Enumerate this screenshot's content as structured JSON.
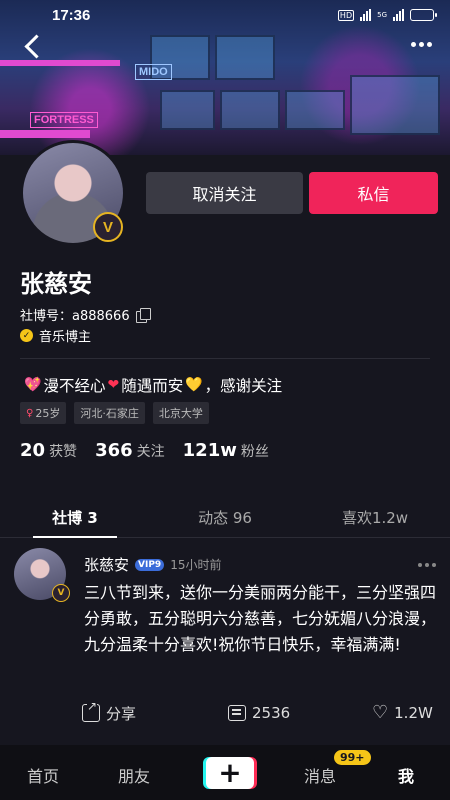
{
  "status": {
    "time": "17:36",
    "hd": "HD",
    "net": "5G",
    "battery_percent": 30
  },
  "banner": {
    "signs": [
      "FORTRESS",
      "MIDO"
    ]
  },
  "profile": {
    "name": "张慈安",
    "id_label": "社博号：a888666",
    "role": "音乐博主",
    "badge": "V",
    "bio_parts": [
      "漫不经心",
      "随遇而安",
      "，感谢关注"
    ],
    "tags": [
      "25岁",
      "河北·石家庄",
      "北京大学"
    ]
  },
  "actions": {
    "unfollow": "取消关注",
    "message": "私信"
  },
  "stats": [
    {
      "value": "20",
      "label": "获赞"
    },
    {
      "value": "366",
      "label": "关注"
    },
    {
      "value": "121w",
      "label": "粉丝"
    }
  ],
  "tabs": [
    {
      "label": "社博 3"
    },
    {
      "label": "动态 96"
    },
    {
      "label": "喜欢1.2w"
    }
  ],
  "post": {
    "author": "张慈安",
    "vip": "VIP9",
    "time": "15小时前",
    "text": "三八节到来，送你一分美丽两分能干，三分坚强四分勇敢，五分聪明六分慈善，七分妩媚八分浪漫，九分温柔十分喜欢!祝你节日快乐，幸福满满!",
    "share_label": "分享",
    "comment_count": "2536",
    "like_count": "1.2W"
  },
  "nav": {
    "home": "首页",
    "friends": "朋友",
    "plus": "+",
    "messages": "消息",
    "messages_badge": "99+",
    "me": "我"
  }
}
